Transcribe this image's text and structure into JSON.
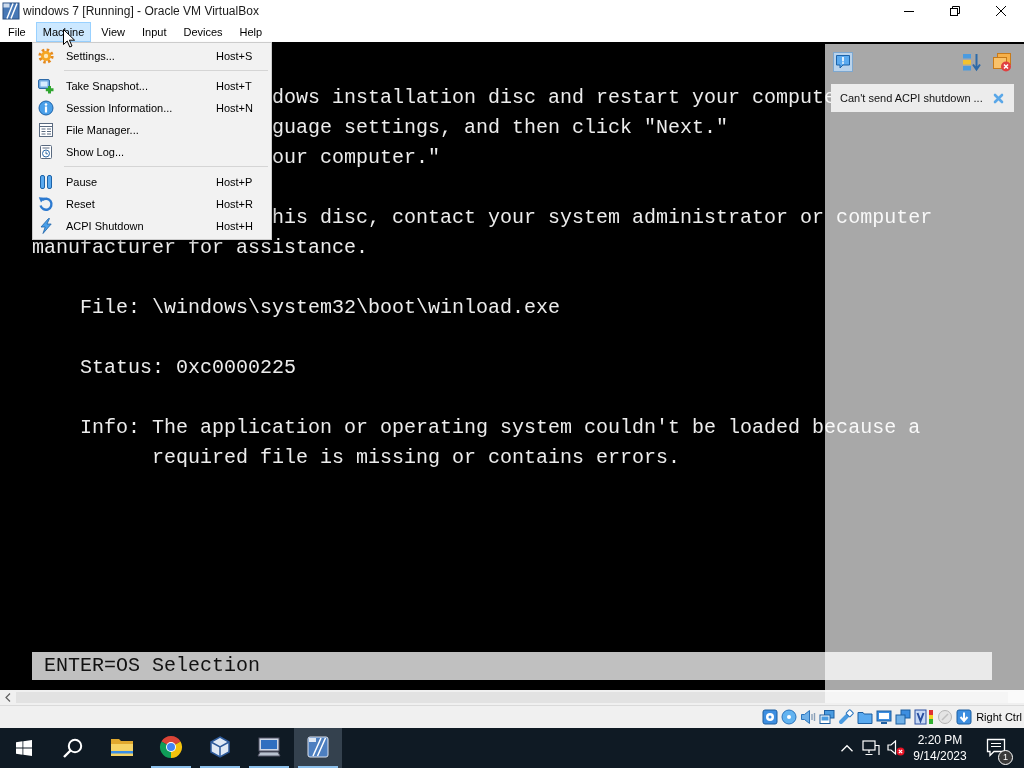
{
  "window": {
    "title": "windows 7 [Running] - Oracle VM VirtualBox"
  },
  "menubar": [
    {
      "label": "File",
      "selected": false
    },
    {
      "label": "Machine",
      "selected": true
    },
    {
      "label": "View",
      "selected": false
    },
    {
      "label": "Input",
      "selected": false
    },
    {
      "label": "Devices",
      "selected": false
    },
    {
      "label": "Help",
      "selected": false
    }
  ],
  "machine_menu": {
    "groups": [
      [
        {
          "label": "Settings...",
          "shortcut": "Host+S"
        }
      ],
      [
        {
          "label": "Take Snapshot...",
          "shortcut": "Host+T"
        },
        {
          "label": "Session Information...",
          "shortcut": "Host+N"
        },
        {
          "label": "File Manager..."
        },
        {
          "label": "Show Log..."
        }
      ],
      [
        {
          "label": "Pause",
          "shortcut": "Host+P"
        },
        {
          "label": "Reset",
          "shortcut": "Host+R"
        },
        {
          "label": "ACPI Shutdown",
          "shortcut": "Host+H"
        }
      ]
    ]
  },
  "console": {
    "paragraphs": [
      [
        {
          "kind": "covered",
          "text": "dows installation disc and restart your compute"
        },
        {
          "kind": "covered",
          "text": "guage settings, and then click \"Next.\""
        },
        {
          "kind": "covered",
          "text": "our computer.\""
        }
      ],
      [
        {
          "kind": "covered",
          "text": "his disc, contact your system administrator or computer"
        },
        {
          "kind": "plain",
          "text": "manufacturer for assistance."
        }
      ],
      [
        {
          "kind": "field",
          "text": "File: \\windows\\system32\\boot\\winload.exe"
        }
      ],
      [
        {
          "kind": "field",
          "text": "Status: 0xc0000225"
        }
      ],
      [
        {
          "kind": "field",
          "text": "Info: The application or operating system couldn't be loaded because a"
        },
        {
          "kind": "continuation",
          "text": "required file is missing or contains errors."
        }
      ]
    ],
    "footer": "ENTER=OS Selection"
  },
  "notification_panel": {
    "messages": [
      {
        "text": "Can't send ACPI shutdown ..."
      }
    ]
  },
  "status_bar": {
    "host_key": "Right Ctrl"
  },
  "taskbar": {
    "apps": [
      {
        "running": false,
        "selected": false
      },
      {
        "running": true,
        "selected": false
      },
      {
        "running": true,
        "selected": false
      },
      {
        "running": true,
        "selected": false
      },
      {
        "running": true,
        "selected": true
      }
    ],
    "clock": {
      "time": "2:20 PM",
      "date": "9/14/2023"
    },
    "notification_count": "1"
  }
}
